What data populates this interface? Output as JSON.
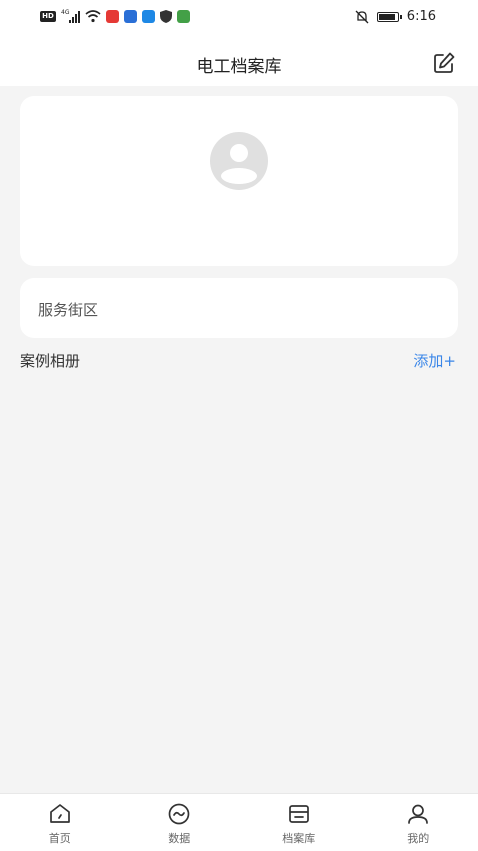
{
  "status_bar": {
    "badge": "HD",
    "network": "4G",
    "time": "6:16",
    "battery_level": 0.8
  },
  "header": {
    "title": "电工档案库"
  },
  "profile": {
    "name": "服务街区"
  },
  "album": {
    "title": "案例相册",
    "add_label": "添加+"
  },
  "tabs": [
    {
      "label": "首页",
      "icon": "home-icon"
    },
    {
      "label": "数据",
      "icon": "data-icon"
    },
    {
      "label": "档案库",
      "icon": "archive-icon"
    },
    {
      "label": "我的",
      "icon": "profile-icon"
    }
  ],
  "colors": {
    "accent": "#3a86e8",
    "background": "#f4f4f4",
    "card": "#ffffff"
  }
}
